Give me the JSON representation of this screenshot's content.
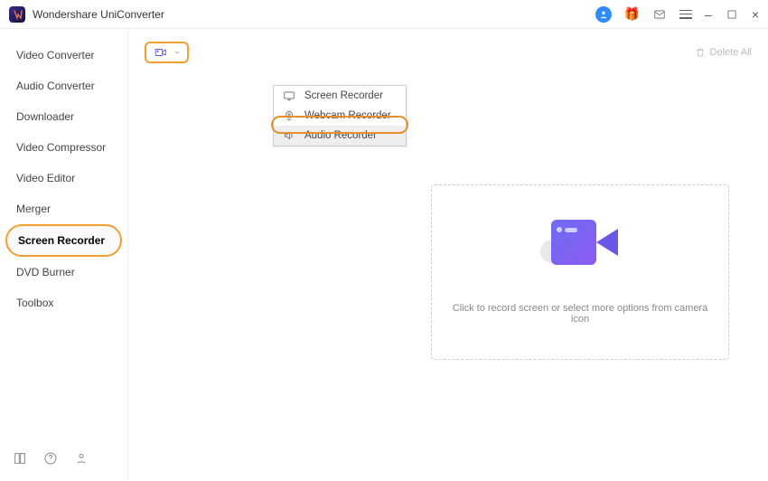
{
  "brand": "Wondershare UniConverter",
  "sidebar": {
    "items": [
      {
        "label": "Video Converter"
      },
      {
        "label": "Audio Converter"
      },
      {
        "label": "Downloader"
      },
      {
        "label": "Video Compressor"
      },
      {
        "label": "Video Editor"
      },
      {
        "label": "Merger"
      },
      {
        "label": "Screen Recorder"
      },
      {
        "label": "DVD Burner"
      },
      {
        "label": "Toolbox"
      }
    ],
    "active_index": 6
  },
  "toolbar": {
    "delete_all_label": "Delete All"
  },
  "dropdown": {
    "items": [
      {
        "label": "Screen Recorder"
      },
      {
        "label": "Webcam Recorder"
      },
      {
        "label": "Audio Recorder"
      }
    ],
    "selected_index": 2
  },
  "dropzone": {
    "text": "Click to record screen or select more options from camera icon"
  }
}
